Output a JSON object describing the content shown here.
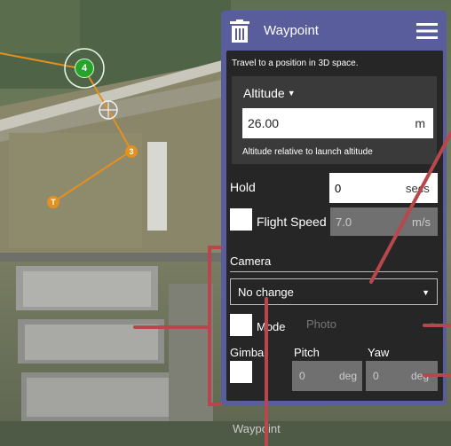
{
  "map": {
    "waypoints": [
      {
        "label": "4",
        "type": "current"
      },
      {
        "label": "3",
        "type": "waypoint"
      },
      {
        "label": "T",
        "type": "takeoff"
      }
    ]
  },
  "panel": {
    "title": "Waypoint",
    "description": "Travel to a position in 3D space.",
    "icons": {
      "left": "trash-icon",
      "right": "menu-icon"
    },
    "altitude": {
      "mode_label": "Altitude",
      "value": "26.00",
      "unit": "m",
      "hint": "Altitude relative to launch altitude"
    },
    "hold": {
      "label": "Hold",
      "value": "0",
      "unit": "secs"
    },
    "flight_speed": {
      "label": "Flight Speed",
      "value": "7.0",
      "unit": "m/s"
    },
    "camera": {
      "section_label": "Camera",
      "action_value": "No change",
      "mode_label": "Mode",
      "mode_value": "Photo",
      "gimbal_label": "Gimbal",
      "pitch_label": "Pitch",
      "pitch_value": "0",
      "pitch_unit": "deg",
      "yaw_label": "Yaw",
      "yaw_value": "0",
      "yaw_unit": "deg"
    }
  },
  "bottom_tab": {
    "label": "Waypoint"
  },
  "colors": {
    "panel_header": "#5a5d9b",
    "panel_body": "#262626",
    "annotation": "#b8474d",
    "waypoint_current": "#27a22a",
    "waypoint_other": "#e4901f"
  }
}
